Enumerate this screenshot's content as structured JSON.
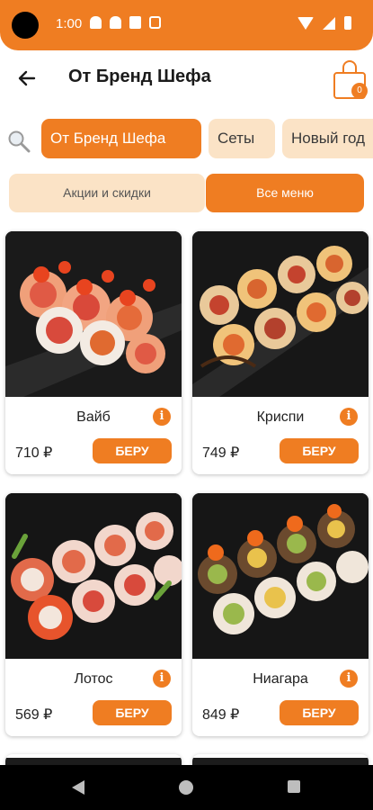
{
  "status_bar": {
    "time": "1:00"
  },
  "header": {
    "title": "От Бренд Шефа",
    "cart_count": "0"
  },
  "categories": [
    {
      "label": "От Бренд Шефа",
      "active": true
    },
    {
      "label": "Сеты",
      "active": false
    },
    {
      "label": "Новый год",
      "active": false
    }
  ],
  "view_toggle": {
    "promo_label": "Акции и скидки",
    "all_label": "Все меню"
  },
  "products": [
    {
      "name": "Вайб",
      "price": "710 ₽",
      "buy_label": "БЕРУ",
      "info_label": "i"
    },
    {
      "name": "Криспи",
      "price": "749 ₽",
      "buy_label": "БЕРУ",
      "info_label": "i"
    },
    {
      "name": "Лотос",
      "price": "569 ₽",
      "buy_label": "БЕРУ",
      "info_label": "i"
    },
    {
      "name": "Ниагара",
      "price": "849 ₽",
      "buy_label": "БЕРУ",
      "info_label": "i"
    }
  ],
  "colors": {
    "accent": "#ef7d22",
    "chip_inactive": "#fbe3c6",
    "nav_background": "#000000"
  }
}
